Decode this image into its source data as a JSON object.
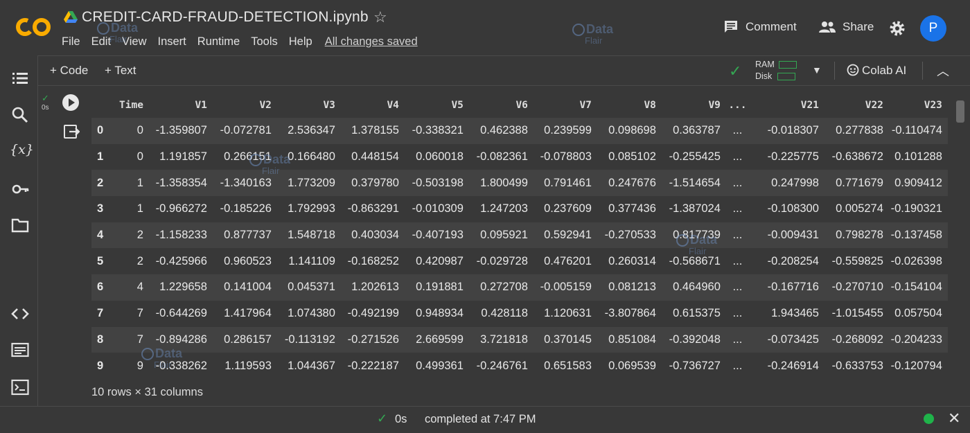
{
  "app": {
    "logo_text": "CO",
    "title": "CREDIT-CARD-FRAUD-DETECTION.ipynb",
    "avatar_initial": "P"
  },
  "menu": [
    "File",
    "Edit",
    "View",
    "Insert",
    "Runtime",
    "Tools",
    "Help"
  ],
  "save_status": "All changes saved",
  "header_actions": {
    "comment": "Comment",
    "share": "Share"
  },
  "watermark": {
    "brand": "Data",
    "sub": "Flair"
  },
  "toolbar": {
    "add_code": "+ Code",
    "add_text": "+ Text",
    "ram_label": "RAM",
    "disk_label": "Disk",
    "colab_ai": "Colab AI"
  },
  "rail_icons": [
    "table-of-contents-icon",
    "search-icon",
    "variables-icon",
    "secrets-key-icon",
    "files-folder-icon",
    "code-snippets-icon",
    "command-palette-icon",
    "terminal-icon"
  ],
  "cell": {
    "exec_time": "0s"
  },
  "dataframe": {
    "columns": [
      "",
      "Time",
      "V1",
      "V2",
      "V3",
      "V4",
      "V5",
      "V6",
      "V7",
      "V8",
      "V9",
      "...",
      "V21",
      "V22",
      "V23"
    ],
    "rows": [
      [
        "0",
        "0",
        "-1.359807",
        "-0.072781",
        "2.536347",
        "1.378155",
        "-0.338321",
        "0.462388",
        "0.239599",
        "0.098698",
        "0.363787",
        "...",
        "-0.018307",
        "0.277838",
        "-0.110474"
      ],
      [
        "1",
        "0",
        "1.191857",
        "0.266151",
        "0.166480",
        "0.448154",
        "0.060018",
        "-0.082361",
        "-0.078803",
        "0.085102",
        "-0.255425",
        "...",
        "-0.225775",
        "-0.638672",
        "0.101288"
      ],
      [
        "2",
        "1",
        "-1.358354",
        "-1.340163",
        "1.773209",
        "0.379780",
        "-0.503198",
        "1.800499",
        "0.791461",
        "0.247676",
        "-1.514654",
        "...",
        "0.247998",
        "0.771679",
        "0.909412"
      ],
      [
        "3",
        "1",
        "-0.966272",
        "-0.185226",
        "1.792993",
        "-0.863291",
        "-0.010309",
        "1.247203",
        "0.237609",
        "0.377436",
        "-1.387024",
        "...",
        "-0.108300",
        "0.005274",
        "-0.190321"
      ],
      [
        "4",
        "2",
        "-1.158233",
        "0.877737",
        "1.548718",
        "0.403034",
        "-0.407193",
        "0.095921",
        "0.592941",
        "-0.270533",
        "0.817739",
        "...",
        "-0.009431",
        "0.798278",
        "-0.137458"
      ],
      [
        "5",
        "2",
        "-0.425966",
        "0.960523",
        "1.141109",
        "-0.168252",
        "0.420987",
        "-0.029728",
        "0.476201",
        "0.260314",
        "-0.568671",
        "...",
        "-0.208254",
        "-0.559825",
        "-0.026398"
      ],
      [
        "6",
        "4",
        "1.229658",
        "0.141004",
        "0.045371",
        "1.202613",
        "0.191881",
        "0.272708",
        "-0.005159",
        "0.081213",
        "0.464960",
        "...",
        "-0.167716",
        "-0.270710",
        "-0.154104"
      ],
      [
        "7",
        "7",
        "-0.644269",
        "1.417964",
        "1.074380",
        "-0.492199",
        "0.948934",
        "0.428118",
        "1.120631",
        "-3.807864",
        "0.615375",
        "...",
        "1.943465",
        "-1.015455",
        "0.057504"
      ],
      [
        "8",
        "7",
        "-0.894286",
        "0.286157",
        "-0.113192",
        "-0.271526",
        "2.669599",
        "3.721818",
        "0.370145",
        "0.851084",
        "-0.392048",
        "...",
        "-0.073425",
        "-0.268092",
        "-0.204233"
      ],
      [
        "9",
        "9",
        "-0.338262",
        "1.119593",
        "1.044367",
        "-0.222187",
        "0.499361",
        "-0.246761",
        "0.651583",
        "0.069539",
        "-0.736727",
        "...",
        "-0.246914",
        "-0.633753",
        "-0.120794"
      ]
    ],
    "shape": "10 rows × 31 columns"
  },
  "status_bar": {
    "time": "0s",
    "completed": "completed at 7:47 PM"
  },
  "colors": {
    "background": "#383838",
    "alt_row": "#424242",
    "accent_blue": "#1a73e8",
    "success_green": "#34a853",
    "logo_orange": "#f9ab00"
  }
}
